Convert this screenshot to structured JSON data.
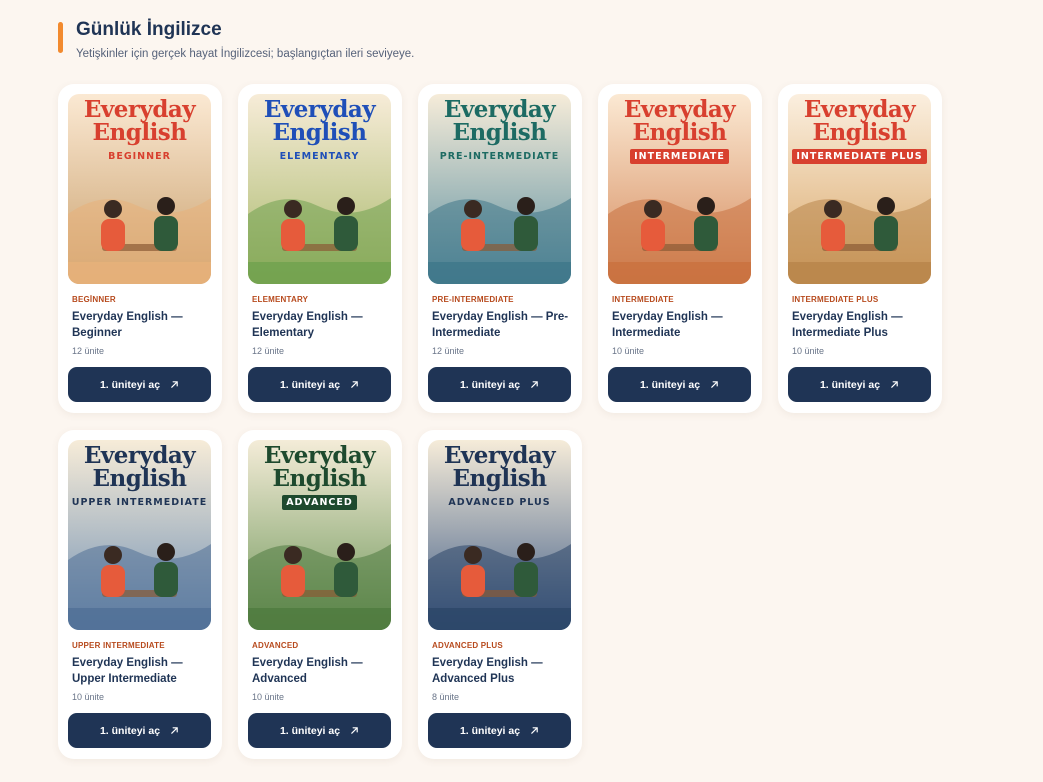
{
  "header": {
    "title": "Günlük İngilizce",
    "subtitle": "Yetişkinler için gerçek hayat İngilizcesi; başlangıçtan ileri seviyeye."
  },
  "cards": [
    {
      "level": "BEGİNNER",
      "title": "Everyday English — Beginner",
      "units": "12 ünite",
      "button": "1. üniteyi aç",
      "cover": {
        "line1": "Everyday",
        "line2": "English",
        "level": "BEGINNER",
        "title_color": "#d8402f",
        "level_color": "#d8402f",
        "bg_top": "#fbe9d3",
        "bg_bottom": "#c9a06d",
        "scene": "#e7b17a",
        "banner": false
      }
    },
    {
      "level": "ELEMENTARY",
      "title": "Everyday English — Elementary",
      "units": "12 ünite",
      "button": "1. üniteyi aç",
      "cover": {
        "line1": "Everyday",
        "line2": "English",
        "level": "ELEMENTARY",
        "title_color": "#1f4fb8",
        "level_color": "#1f4fb8",
        "bg_top": "#f7ecd8",
        "bg_bottom": "#a8b86a",
        "scene": "#6fa14e",
        "banner": false
      }
    },
    {
      "level": "PRE-INTERMEDIATE",
      "title": "Everyday English — Pre-Intermediate",
      "units": "12 ünite",
      "button": "1. üniteyi aç",
      "cover": {
        "line1": "Everyday",
        "line2": "English",
        "level": "PRE-INTERMEDIATE",
        "title_color": "#1d6b63",
        "level_color": "#1d6b63",
        "bg_top": "#f6ecd9",
        "bg_bottom": "#5b8fa0",
        "scene": "#3f7789",
        "banner": false
      }
    },
    {
      "level": "INTERMEDIATE",
      "title": "Everyday English — Intermediate",
      "units": "10 ünite",
      "button": "1. üniteyi aç",
      "cover": {
        "line1": "Everyday",
        "line2": "English",
        "level": "INTERMEDIATE",
        "title_color": "#d8402f",
        "level_color": "#ffffff",
        "bg_top": "#fbe9d3",
        "bg_bottom": "#d58a5c",
        "scene": "#c9713f",
        "banner": true
      }
    },
    {
      "level": "INTERMEDIATE PLUS",
      "title": "Everyday English — Intermediate Plus",
      "units": "10 ünite",
      "button": "1. üniteyi aç",
      "cover": {
        "line1": "Everyday",
        "line2": "English",
        "level": "INTERMEDIATE PLUS",
        "title_color": "#d8402f",
        "level_color": "#ffffff",
        "bg_top": "#fbefdf",
        "bg_bottom": "#d9a768",
        "scene": "#b8854a",
        "banner": true
      }
    },
    {
      "level": "UPPER INTERMEDIATE",
      "title": "Everyday English — Upper Intermediate",
      "units": "10 ünite",
      "button": "1. üniteyi aç",
      "cover": {
        "line1": "Everyday",
        "line2": "English",
        "level": "UPPER INTERMEDIATE",
        "title_color": "#1f3455",
        "level_color": "#1f3455",
        "bg_top": "#f7ecd8",
        "bg_bottom": "#6f8fb3",
        "scene": "#506f96",
        "banner": false
      }
    },
    {
      "level": "ADVANCED",
      "title": "Everyday English — Advanced",
      "units": "10 ünite",
      "button": "1. üniteyi aç",
      "cover": {
        "line1": "Everyday",
        "line2": "English",
        "level": "ADVANCED",
        "title_color": "#1e4a2e",
        "level_color": "#ffffff",
        "bg_top": "#f4ecd8",
        "bg_bottom": "#6c9557",
        "scene": "#4f7a3f",
        "banner": true
      }
    },
    {
      "level": "ADVANCED PLUS",
      "title": "Everyday English — Advanced Plus",
      "units": "8 ünite",
      "button": "1. üniteyi aç",
      "cover": {
        "line1": "Everyday",
        "line2": "English",
        "level": "ADVANCED PLUS",
        "title_color": "#1f3455",
        "level_color": "#1f3455",
        "bg_top": "#f6ecd9",
        "bg_bottom": "#3d5a85",
        "scene": "#2c4668",
        "banner": false
      }
    }
  ],
  "icons": {
    "button_icon": "arrow-up-right-icon"
  }
}
